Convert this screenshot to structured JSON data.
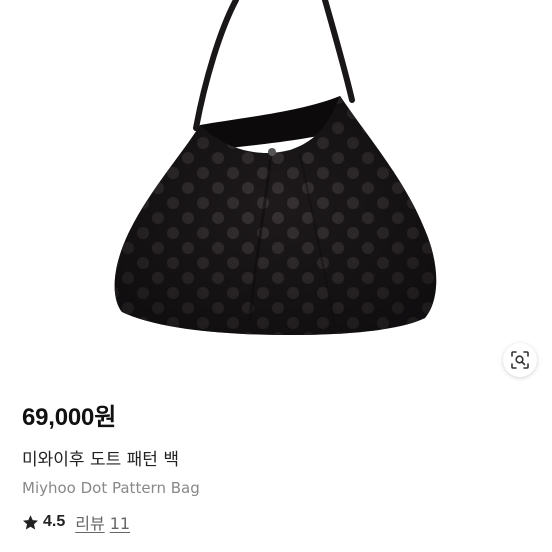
{
  "product": {
    "price": "69,000원",
    "title_ko": "미와이후 도트 패턴 백",
    "title_en": "Miyhoo Dot Pattern Bag",
    "rating": "4.5",
    "review_label": "리뷰",
    "review_count": "11"
  },
  "icons": {
    "lens": "visual-search-icon",
    "star": "star-icon"
  },
  "colors": {
    "bag": "#1c191b",
    "dots": "#3a3437",
    "price_text": "#111111",
    "secondary_text": "#888888"
  }
}
